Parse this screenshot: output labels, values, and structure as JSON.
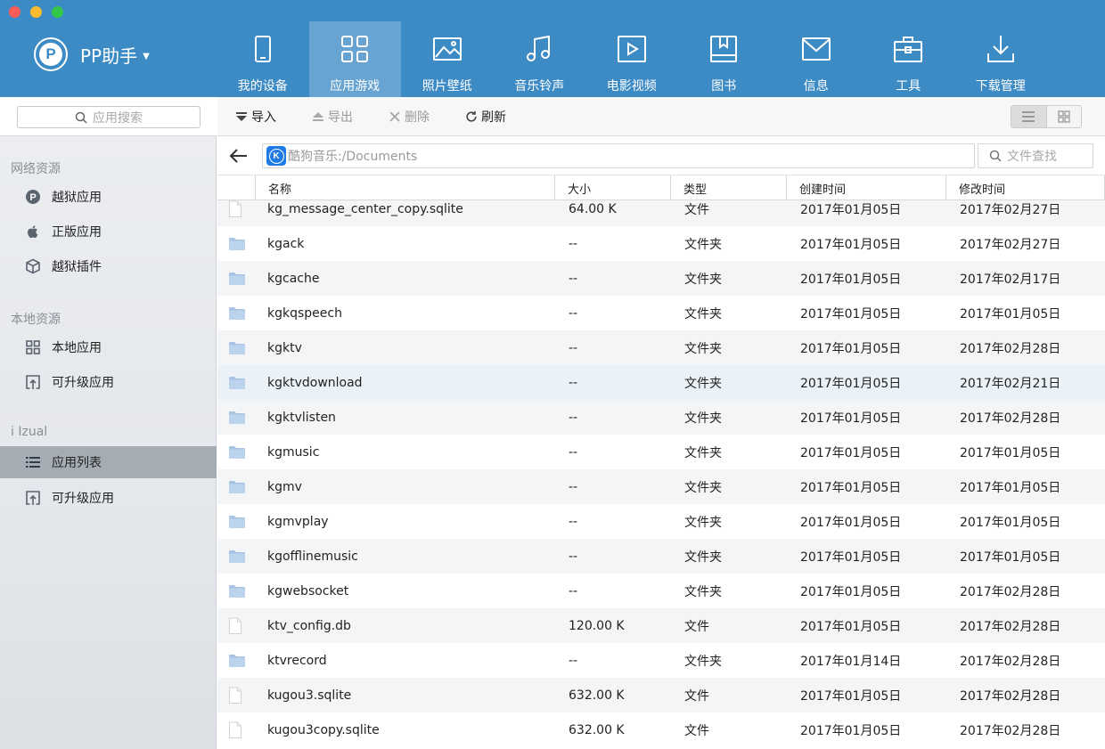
{
  "app": {
    "name": "PP助手",
    "colors": {
      "accent": "#3d8bc4",
      "sidebar": "#e5e8eb",
      "selected": "#a5acb4"
    }
  },
  "nav": {
    "tabs": [
      {
        "label": "我的设备",
        "icon": "phone-icon"
      },
      {
        "label": "应用游戏",
        "icon": "apps-grid-icon",
        "active": true
      },
      {
        "label": "照片壁纸",
        "icon": "picture-icon"
      },
      {
        "label": "音乐铃声",
        "icon": "music-note-icon"
      },
      {
        "label": "电影视频",
        "icon": "video-play-icon"
      },
      {
        "label": "图书",
        "icon": "book-icon"
      },
      {
        "label": "信息",
        "icon": "envelope-icon"
      },
      {
        "label": "工具",
        "icon": "toolbox-icon"
      },
      {
        "label": "下载管理",
        "icon": "download-icon"
      }
    ]
  },
  "sidebar": {
    "search_placeholder": "应用搜索",
    "groups": [
      {
        "title": "网络资源",
        "items": [
          {
            "label": "越狱应用",
            "icon": "pp-logo-icon"
          },
          {
            "label": "正版应用",
            "icon": "apple-icon"
          },
          {
            "label": "越狱插件",
            "icon": "cube-icon"
          }
        ]
      },
      {
        "title": "本地资源",
        "items": [
          {
            "label": "本地应用",
            "icon": "grid-icon"
          },
          {
            "label": "可升级应用",
            "icon": "upgrade-icon"
          }
        ]
      },
      {
        "title": "i Izual",
        "items": [
          {
            "label": "应用列表",
            "icon": "list-icon",
            "active": true
          },
          {
            "label": "可升级应用",
            "icon": "upgrade-icon"
          }
        ]
      }
    ]
  },
  "toolbar": {
    "import_label": "导入",
    "export_label": "导出",
    "delete_label": "删除",
    "refresh_label": "刷新"
  },
  "path": {
    "value": "酷狗音乐:/Documents",
    "search_placeholder": "文件查找"
  },
  "table": {
    "columns": [
      "名称",
      "大小",
      "类型",
      "创建时间",
      "修改时间"
    ],
    "rows": [
      {
        "kind": "file",
        "name": "kg_message_center_copy.sqlite",
        "size": "64.00 K",
        "type": "文件",
        "created": "2017年01月05日",
        "modified": "2017年02月27日"
      },
      {
        "kind": "folder",
        "name": "kgack",
        "size": "--",
        "type": "文件夹",
        "created": "2017年01月05日",
        "modified": "2017年02月27日"
      },
      {
        "kind": "folder",
        "name": "kgcache",
        "size": "--",
        "type": "文件夹",
        "created": "2017年01月05日",
        "modified": "2017年02月17日"
      },
      {
        "kind": "folder",
        "name": "kgkqspeech",
        "size": "--",
        "type": "文件夹",
        "created": "2017年01月05日",
        "modified": "2017年01月05日"
      },
      {
        "kind": "folder",
        "name": "kgktv",
        "size": "--",
        "type": "文件夹",
        "created": "2017年01月05日",
        "modified": "2017年02月28日"
      },
      {
        "kind": "folder",
        "name": "kgktvdownload",
        "size": "--",
        "type": "文件夹",
        "created": "2017年01月05日",
        "modified": "2017年02月21日"
      },
      {
        "kind": "folder",
        "name": "kgktvlisten",
        "size": "--",
        "type": "文件夹",
        "created": "2017年01月05日",
        "modified": "2017年02月28日"
      },
      {
        "kind": "folder",
        "name": "kgmusic",
        "size": "--",
        "type": "文件夹",
        "created": "2017年01月05日",
        "modified": "2017年01月05日"
      },
      {
        "kind": "folder",
        "name": "kgmv",
        "size": "--",
        "type": "文件夹",
        "created": "2017年01月05日",
        "modified": "2017年01月05日"
      },
      {
        "kind": "folder",
        "name": "kgmvplay",
        "size": "--",
        "type": "文件夹",
        "created": "2017年01月05日",
        "modified": "2017年01月05日"
      },
      {
        "kind": "folder",
        "name": "kgofflinemusic",
        "size": "--",
        "type": "文件夹",
        "created": "2017年01月05日",
        "modified": "2017年01月05日"
      },
      {
        "kind": "folder",
        "name": "kgwebsocket",
        "size": "--",
        "type": "文件夹",
        "created": "2017年01月05日",
        "modified": "2017年02月28日"
      },
      {
        "kind": "file",
        "name": "ktv_config.db",
        "size": "120.00 K",
        "type": "文件",
        "created": "2017年01月05日",
        "modified": "2017年02月28日"
      },
      {
        "kind": "folder",
        "name": "ktvrecord",
        "size": "--",
        "type": "文件夹",
        "created": "2017年01月14日",
        "modified": "2017年02月28日"
      },
      {
        "kind": "file",
        "name": "kugou3.sqlite",
        "size": "632.00 K",
        "type": "文件",
        "created": "2017年01月05日",
        "modified": "2017年02月28日"
      },
      {
        "kind": "file",
        "name": "kugou3copy.sqlite",
        "size": "632.00 K",
        "type": "文件",
        "created": "2017年01月05日",
        "modified": "2017年02月28日"
      }
    ]
  }
}
